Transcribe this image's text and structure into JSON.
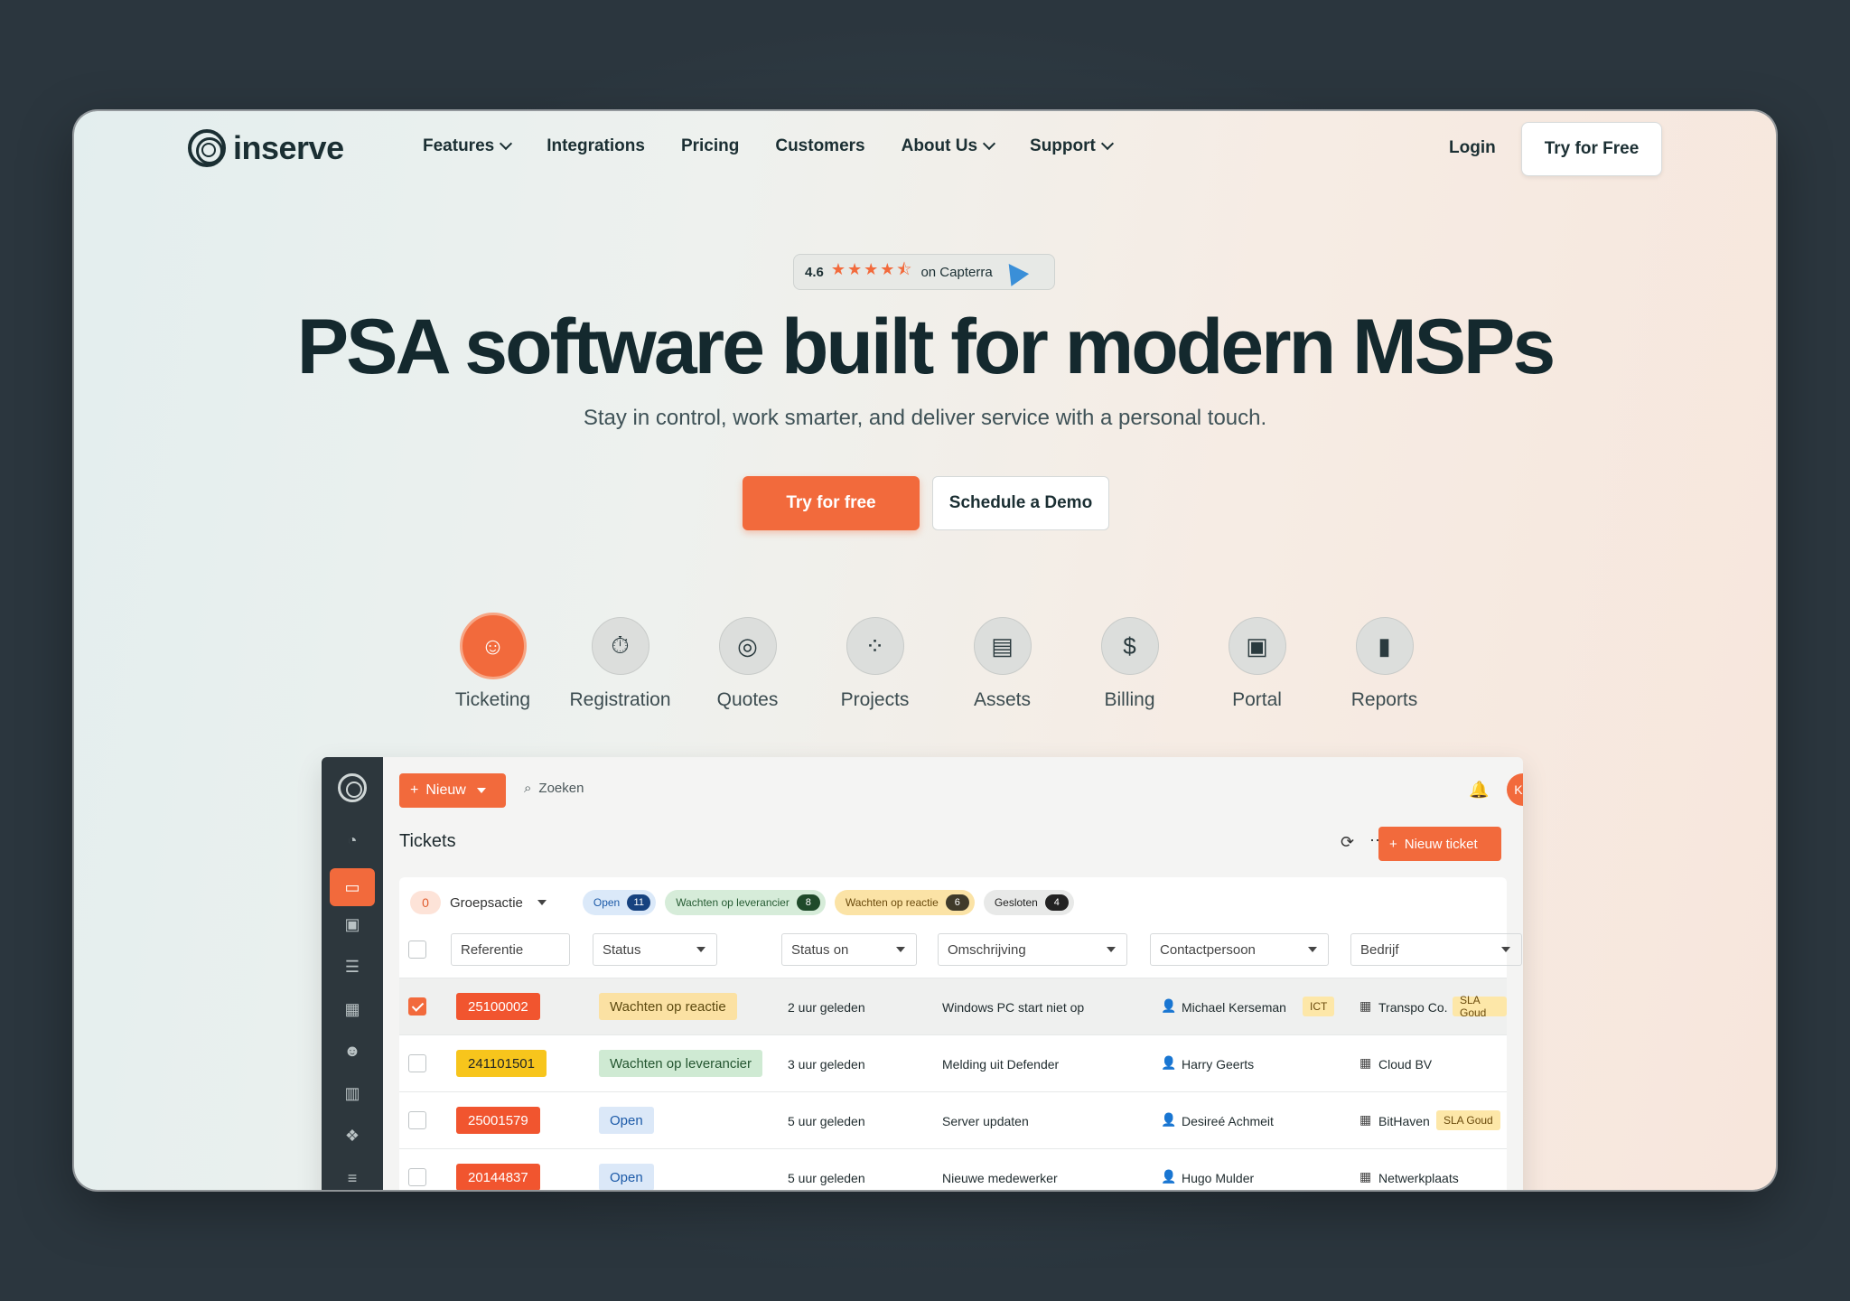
{
  "brand": {
    "name": "inserve"
  },
  "nav": {
    "items": [
      {
        "label": "Features",
        "dropdown": true
      },
      {
        "label": "Integrations",
        "dropdown": false
      },
      {
        "label": "Pricing",
        "dropdown": false
      },
      {
        "label": "Customers",
        "dropdown": false
      },
      {
        "label": "About Us",
        "dropdown": true
      },
      {
        "label": "Support",
        "dropdown": true
      }
    ],
    "login": "Login",
    "try": "Try for Free"
  },
  "rating": {
    "score": "4.6",
    "stars": "★★★★⯪",
    "source": "on Capterra"
  },
  "hero": {
    "title": "PSA software built for modern MSPs",
    "subtitle": "Stay in control, work smarter, and deliver service with a personal touch.",
    "cta_primary": "Try for free",
    "cta_secondary": "Schedule a Demo"
  },
  "features": [
    {
      "label": "Ticketing",
      "icon": "headset-icon",
      "glyph": "☺",
      "active": true
    },
    {
      "label": "Registration",
      "icon": "stopwatch-icon",
      "glyph": "⏱"
    },
    {
      "label": "Quotes",
      "icon": "target-icon",
      "glyph": "◎"
    },
    {
      "label": "Projects",
      "icon": "grid-icon",
      "glyph": "⁘"
    },
    {
      "label": "Assets",
      "icon": "server-icon",
      "glyph": "▤"
    },
    {
      "label": "Billing",
      "icon": "invoice-icon",
      "glyph": "$"
    },
    {
      "label": "Portal",
      "icon": "browser-icon",
      "glyph": "▣"
    },
    {
      "label": "Reports",
      "icon": "bar-chart-icon",
      "glyph": "▮"
    }
  ],
  "app": {
    "new_label": "Nieuw",
    "search_label": "Zoeken",
    "avatar": "KN",
    "page_title": "Tickets",
    "new_ticket": "Nieuw ticket",
    "groups_count": "0",
    "groups_label": "Groepsactie",
    "chips": [
      {
        "label": "Open",
        "count": "11"
      },
      {
        "label": "Wachten op leverancier",
        "count": "8"
      },
      {
        "label": "Wachten op reactie",
        "count": "6"
      },
      {
        "label": "Gesloten",
        "count": "4"
      }
    ],
    "columns": [
      "Referentie",
      "Status",
      "Status on",
      "Omschrijving",
      "Contactpersoon",
      "Bedrijf"
    ],
    "rows": [
      {
        "ref": "25100002",
        "status": "Wachten op reactie",
        "since": "2 uur geleden",
        "desc": "Windows PC start niet op",
        "contact": "Michael Kerseman",
        "contact_tag": "ICT",
        "company": "Transpo Co.",
        "company_tag": "SLA Goud",
        "selected": true
      },
      {
        "ref": "241101501",
        "status": "Wachten op leverancier",
        "since": "3 uur geleden",
        "desc": "Melding uit Defender",
        "contact": "Harry Geerts",
        "company": "Cloud BV"
      },
      {
        "ref": "25001579",
        "status": "Open",
        "since": "5 uur geleden",
        "desc": "Server updaten",
        "contact": "Desireé Achmeit",
        "company": "BitHaven",
        "company_tag": "SLA Goud"
      },
      {
        "ref": "20144837",
        "status": "Open",
        "since": "5 uur geleden",
        "desc": "Nieuwe medewerker",
        "contact": "Hugo Mulder",
        "company": "Netwerkplaats"
      }
    ]
  }
}
